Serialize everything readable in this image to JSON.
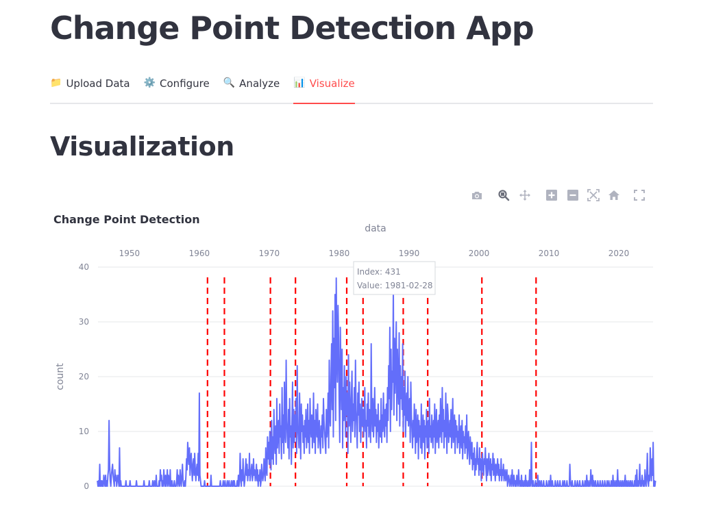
{
  "app": {
    "title": "Change Point Detection App"
  },
  "tabs": [
    {
      "icon": "📁",
      "label": "Upload Data",
      "active": false
    },
    {
      "icon": "⚙️",
      "label": "Configure",
      "active": false
    },
    {
      "icon": "🔍",
      "label": "Analyze",
      "active": false
    },
    {
      "icon": "📊",
      "label": "Visualize",
      "active": true
    }
  ],
  "section": {
    "title": "Visualization"
  },
  "modebar": [
    "camera-icon",
    "zoom-icon",
    "pan-icon",
    "zoom-in-icon",
    "zoom-out-icon",
    "autoscale-icon",
    "reset-axes-icon",
    "fullscreen-icon"
  ],
  "colors": {
    "accent": "#ff4b4b",
    "series": "#636efa",
    "changepoint": "#ff0000",
    "grid": "#e6e7ea"
  },
  "tooltip": {
    "line1": "Index: 431",
    "line2": "Value: 1981-02-28"
  },
  "chart_data": {
    "type": "line",
    "title": "Change Point Detection",
    "xlabel": "data",
    "ylabel": "count",
    "x_axis_position": "top",
    "x_ticks": [
      "1950",
      "1960",
      "1970",
      "1980",
      "1990",
      "2000",
      "2010",
      "2020"
    ],
    "xlim": [
      1945.5,
      2024.9
    ],
    "ylim": [
      0,
      40
    ],
    "y_ticks": [
      0,
      10,
      20,
      30,
      40
    ],
    "grid": true,
    "series": [
      {
        "x_start": "1945-06",
        "x_step": "1 month",
        "values": [
          1,
          0,
          1,
          0,
          4,
          0,
          1,
          0,
          1,
          0,
          0,
          2,
          1,
          0,
          2,
          0,
          1,
          0,
          2,
          3,
          12,
          4,
          1,
          0,
          2,
          3,
          4,
          2,
          1,
          0,
          3,
          1,
          2,
          0,
          1,
          2,
          1,
          0,
          7,
          0,
          1,
          0,
          0,
          0,
          0,
          0,
          0,
          0,
          0,
          1,
          0,
          0,
          0,
          0,
          0,
          0,
          1,
          0,
          0,
          0,
          0,
          0,
          0,
          0,
          0,
          0,
          0,
          1,
          0,
          0,
          0,
          0,
          0,
          0,
          0,
          0,
          0,
          0,
          0,
          0,
          1,
          0,
          0,
          0,
          0,
          0,
          0,
          0,
          0,
          1,
          0,
          0,
          0,
          0,
          0,
          1,
          0,
          0,
          1,
          0,
          0,
          2,
          0,
          0,
          0,
          0,
          1,
          0,
          3,
          1,
          2,
          0,
          1,
          0,
          3,
          1,
          0,
          2,
          0,
          1,
          3,
          0,
          2,
          1,
          0,
          3,
          0,
          0,
          1,
          0,
          0,
          0,
          1,
          0,
          0,
          0,
          1,
          3,
          0,
          2,
          1,
          0,
          3,
          1,
          0,
          2,
          4,
          1,
          0,
          0,
          1,
          0,
          2,
          5,
          3,
          8,
          6,
          4,
          7,
          2,
          5,
          6,
          3,
          1,
          4,
          5,
          2,
          6,
          3,
          1,
          3,
          4,
          2,
          6,
          1,
          17,
          2,
          1,
          0,
          0,
          0,
          0,
          0,
          0,
          1,
          0,
          0,
          0,
          0,
          0,
          0,
          0,
          0,
          0,
          0,
          2,
          0,
          0,
          0,
          0,
          0,
          0,
          0,
          0,
          0,
          0,
          0,
          0,
          0,
          0,
          0,
          1,
          0,
          0,
          0,
          0,
          1,
          0,
          0,
          1,
          0,
          0,
          0,
          1,
          0,
          0,
          1,
          0,
          0,
          0,
          1,
          0,
          0,
          1,
          0,
          1,
          0,
          0,
          0,
          0,
          1,
          0,
          2,
          0,
          1,
          6,
          2,
          0,
          3,
          1,
          5,
          2,
          0,
          1,
          3,
          5,
          2,
          4,
          1,
          3,
          2,
          6,
          1,
          2,
          3,
          4,
          1,
          2,
          5,
          2,
          3,
          1,
          2,
          4,
          1,
          3,
          0,
          2,
          1,
          3,
          0,
          1,
          4,
          2,
          1,
          2,
          5,
          3,
          1,
          7,
          3,
          2,
          9,
          5,
          8,
          4,
          10,
          6,
          3,
          12,
          5,
          9,
          4,
          14,
          8,
          6,
          11,
          4,
          16,
          7,
          10,
          12,
          6,
          15,
          9,
          11,
          5,
          18,
          8,
          13,
          6,
          19,
          10,
          8,
          23,
          12,
          9,
          7,
          14,
          5,
          16,
          9,
          11,
          4,
          12,
          19,
          7,
          14,
          8,
          13,
          10,
          16,
          6,
          22,
          11,
          9,
          7,
          17,
          12,
          5,
          15,
          10,
          13,
          8,
          11,
          6,
          12,
          9,
          14,
          7,
          10,
          15,
          8,
          12,
          6,
          16,
          11,
          9,
          13,
          7,
          10,
          17,
          8,
          12,
          6,
          14,
          11,
          9,
          15,
          7,
          10,
          12,
          8,
          6,
          11,
          9,
          13,
          7,
          16,
          12,
          10,
          8,
          6,
          14,
          9,
          11,
          17,
          7,
          23,
          13,
          11,
          20,
          26,
          14,
          32,
          9,
          27,
          18,
          35,
          12,
          38,
          24,
          19,
          33,
          27,
          16,
          8,
          29,
          21,
          14,
          25,
          7,
          18,
          12,
          22,
          15,
          9,
          20,
          13,
          17,
          6,
          24,
          11,
          19,
          14,
          8,
          16,
          21,
          10,
          15,
          12,
          18,
          9,
          23,
          14,
          11,
          7,
          17,
          13,
          19,
          10,
          15,
          8,
          12,
          16,
          11,
          14,
          9,
          13,
          18,
          10,
          12,
          7,
          15,
          11,
          17,
          9,
          14,
          12,
          8,
          26,
          13,
          10,
          16,
          9,
          12,
          18,
          11,
          14,
          8,
          13,
          10,
          15,
          7,
          11,
          12,
          9,
          16,
          8,
          13,
          10,
          17,
          12,
          9,
          14,
          11,
          15,
          8,
          18,
          12,
          22,
          16,
          29,
          10,
          25,
          14,
          21,
          19,
          36,
          13,
          27,
          17,
          23,
          30,
          12,
          25,
          19,
          15,
          28,
          11,
          22,
          16,
          20,
          14,
          26,
          10,
          18,
          13,
          21,
          9,
          15,
          17,
          12,
          20,
          11,
          14,
          16,
          8,
          19,
          13,
          10,
          7,
          12,
          9,
          15,
          11,
          6,
          14,
          8,
          10,
          13,
          5,
          12,
          9,
          11,
          7,
          15,
          6,
          10,
          13,
          8,
          12,
          5,
          11,
          9,
          14,
          7,
          10,
          12,
          6,
          16,
          9,
          11,
          8,
          13,
          10,
          7,
          12,
          9,
          15,
          6,
          11,
          14,
          8,
          10,
          12,
          7,
          13,
          9,
          16,
          11,
          8,
          18,
          10,
          14,
          7,
          12,
          9,
          17,
          11,
          6,
          15,
          13,
          8,
          10,
          12,
          9,
          14,
          7,
          11,
          16,
          8,
          10,
          13,
          6,
          12,
          9,
          11,
          7,
          10,
          8,
          13,
          6,
          9,
          11,
          7,
          12,
          5,
          10,
          8,
          9,
          6,
          11,
          7,
          13,
          5,
          8,
          10,
          6,
          4,
          9,
          7,
          5,
          8,
          3,
          6,
          4,
          7,
          2,
          5,
          3,
          6,
          8,
          4,
          5,
          2,
          7,
          3,
          5,
          1,
          4,
          6,
          3,
          2,
          5,
          4,
          7,
          3,
          1,
          5,
          2,
          4,
          6,
          3,
          2,
          5,
          1,
          4,
          3,
          6,
          2,
          5,
          3,
          1,
          4,
          2,
          3,
          5,
          2,
          4,
          1,
          3,
          2,
          5,
          1,
          3,
          2,
          4,
          1,
          2,
          3,
          1,
          2,
          3,
          0,
          1,
          2,
          1,
          0,
          1,
          2,
          0,
          3,
          1,
          0,
          2,
          1,
          0,
          1,
          0,
          2,
          1,
          0,
          3,
          1,
          0,
          1,
          0,
          2,
          0,
          1,
          0,
          0,
          1,
          0,
          2,
          0,
          1,
          0,
          0,
          1,
          0,
          3,
          0,
          1,
          8,
          0,
          0,
          1,
          0,
          0,
          0,
          1,
          0,
          0,
          0,
          2,
          0,
          0,
          1,
          0,
          0,
          1,
          0,
          0,
          0,
          1,
          0,
          0,
          0,
          0,
          1,
          0,
          0,
          0,
          1,
          0,
          0,
          2,
          0,
          0,
          1,
          0,
          0,
          0,
          0,
          1,
          0,
          0,
          0,
          1,
          0,
          0,
          0,
          1,
          0,
          0,
          0,
          0,
          1,
          0,
          0,
          1,
          0,
          0,
          0,
          1,
          0,
          0,
          0,
          0,
          4,
          1,
          0,
          0,
          1,
          0,
          0,
          0,
          0,
          1,
          0,
          0,
          0,
          1,
          0,
          0,
          0,
          1,
          0,
          0,
          0,
          0,
          1,
          0,
          0,
          0,
          1,
          0,
          0,
          2,
          0,
          1,
          0,
          0,
          1,
          0,
          3,
          1,
          0,
          2,
          0,
          1,
          0,
          0,
          1,
          0,
          0,
          0,
          1,
          0,
          0,
          0,
          1,
          0,
          0,
          0,
          1,
          0,
          0,
          0,
          1,
          0,
          0,
          0,
          1,
          0,
          0,
          1,
          0,
          0,
          0,
          1,
          0,
          0,
          2,
          0,
          1,
          0,
          0,
          1,
          0,
          0,
          3,
          0,
          1,
          0,
          0,
          1,
          0,
          0,
          1,
          0,
          0,
          1,
          0,
          2,
          0,
          0,
          1,
          0,
          0,
          1,
          0,
          0,
          1,
          0,
          0,
          1,
          0,
          0,
          0,
          1,
          0,
          2,
          0,
          3,
          0,
          1,
          0,
          1,
          4,
          0,
          1,
          0,
          2,
          1,
          0,
          1,
          0,
          3,
          1,
          0,
          2,
          6,
          1,
          0,
          2,
          1,
          7,
          3,
          1,
          5,
          2,
          8,
          0,
          1,
          0,
          1
        ]
      }
    ],
    "change_points": [
      "1961-03",
      "1963-08",
      "1970-03",
      "1973-10",
      "1981-02",
      "1983-06",
      "1989-03",
      "1992-09",
      "2000-06",
      "2008-03"
    ]
  }
}
